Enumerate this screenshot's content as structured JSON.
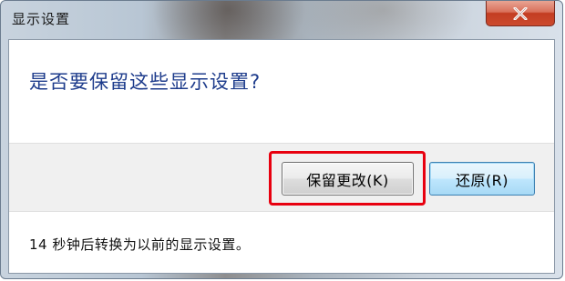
{
  "window": {
    "title": "显示设置"
  },
  "dialog": {
    "question": "是否要保留这些显示设置?",
    "buttons": {
      "keep_label": "保留更改(K)",
      "revert_label": "还原(R)"
    },
    "status_text": "14 秒钟后转换为以前的显示设置。",
    "countdown_seconds": 14
  },
  "icons": {
    "close": "close-icon"
  },
  "colors": {
    "question_text": "#1e3c8c",
    "highlight_border": "#e8000f",
    "close_button": "#c33d22"
  }
}
